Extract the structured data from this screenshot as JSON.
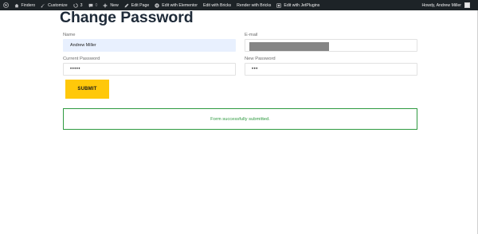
{
  "adminbar": {
    "site_name": "Findero",
    "customize": "Customize",
    "updates_count": "3",
    "comments_count": "0",
    "new": "New",
    "edit_page": "Edit Page",
    "edit_elementor": "Edit with Elementor",
    "edit_bricks": "Edit with Bricks",
    "render_bricks": "Render with Bricks",
    "edit_jetplugins": "Edit with JetPlugins",
    "howdy": "Howdy, Andrew Miller"
  },
  "page": {
    "title": "Change Password"
  },
  "form": {
    "name_label": "Name",
    "name_value": "Andrew Miller",
    "email_label": "E-mail",
    "current_password_label": "Current Password",
    "current_password_value": "•••••",
    "new_password_label": "New Password",
    "new_password_value": "•••",
    "submit_label": "SUBMIT",
    "success_message": "Form successfully submitted."
  },
  "colors": {
    "adminbar_bg": "#1d2327",
    "submit_bg": "#ffc80a",
    "success": "#2e9a40",
    "autofill_bg": "#e8f0fe"
  }
}
